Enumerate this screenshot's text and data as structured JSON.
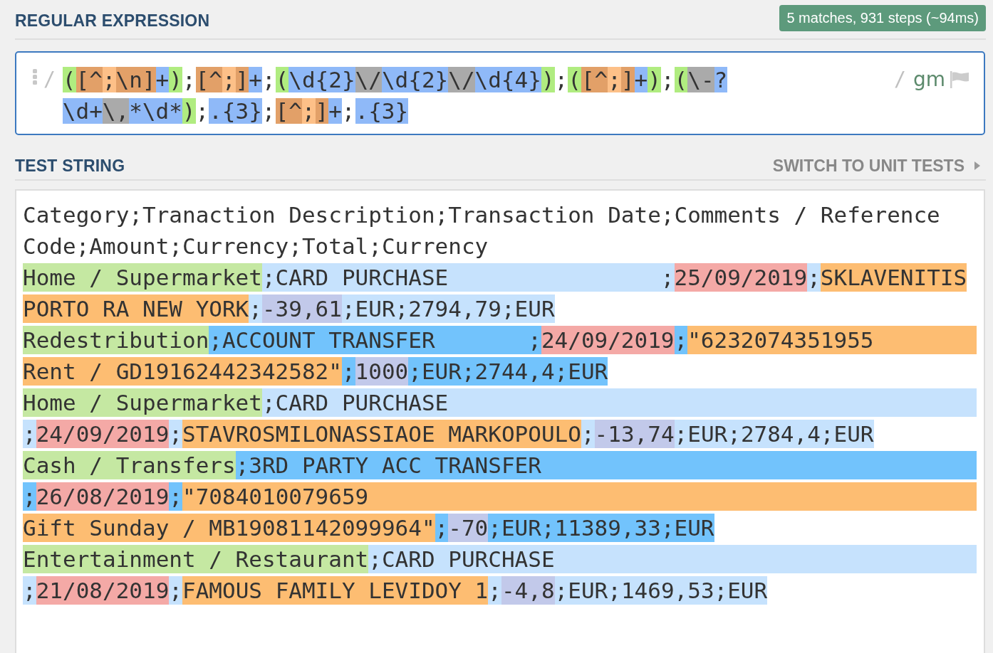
{
  "regex_section": {
    "title": "REGULAR EXPRESSION",
    "badge": "5 matches, 931 steps (~94ms)"
  },
  "regex": {
    "open_delimiter": "/",
    "close_delimiter": "/",
    "flags": "gm",
    "lines": [
      [
        {
          "text": "(",
          "kind": "group"
        },
        {
          "text": "[^",
          "kind": "set"
        },
        {
          "text": ";",
          "kind": "setitem"
        },
        {
          "text": "\\n]",
          "kind": "set"
        },
        {
          "text": "+",
          "kind": "token"
        },
        {
          "text": ")",
          "kind": "group"
        },
        {
          "text": ";",
          "kind": "plain"
        },
        {
          "text": "[^",
          "kind": "set"
        },
        {
          "text": ";",
          "kind": "setitem"
        },
        {
          "text": "]",
          "kind": "set"
        },
        {
          "text": "+",
          "kind": "token"
        },
        {
          "text": ";",
          "kind": "plain"
        },
        {
          "text": "(",
          "kind": "group"
        },
        {
          "text": "\\d{2}",
          "kind": "token"
        },
        {
          "text": "\\/",
          "kind": "escape"
        },
        {
          "text": "\\d{2}",
          "kind": "token"
        },
        {
          "text": "\\/",
          "kind": "escape"
        },
        {
          "text": "\\d{4}",
          "kind": "token"
        },
        {
          "text": ")",
          "kind": "group"
        },
        {
          "text": ";",
          "kind": "plain"
        },
        {
          "text": "(",
          "kind": "group"
        },
        {
          "text": "[^",
          "kind": "set"
        },
        {
          "text": ";",
          "kind": "setitem"
        },
        {
          "text": "]",
          "kind": "set"
        },
        {
          "text": "+",
          "kind": "token"
        },
        {
          "text": ")",
          "kind": "group"
        },
        {
          "text": ";",
          "kind": "plain"
        },
        {
          "text": "(",
          "kind": "group"
        },
        {
          "text": "\\-",
          "kind": "escape"
        },
        {
          "text": "?",
          "kind": "token"
        }
      ],
      [
        {
          "text": "\\d+",
          "kind": "token"
        },
        {
          "text": "\\,",
          "kind": "escape"
        },
        {
          "text": "*\\d*",
          "kind": "token"
        },
        {
          "text": ")",
          "kind": "group"
        },
        {
          "text": ";",
          "kind": "plain"
        },
        {
          "text": ".{3}",
          "kind": "token"
        },
        {
          "text": ";",
          "kind": "plain"
        },
        {
          "text": "[^",
          "kind": "set"
        },
        {
          "text": ";",
          "kind": "setitem"
        },
        {
          "text": "]",
          "kind": "set"
        },
        {
          "text": "+",
          "kind": "token"
        },
        {
          "text": ";",
          "kind": "plain"
        },
        {
          "text": ".{3}",
          "kind": "token"
        }
      ]
    ]
  },
  "test_section": {
    "title": "TEST STRING",
    "switch_link": "SWITCH TO UNIT TESTS"
  },
  "test_string": {
    "lines": [
      {
        "segments": [
          {
            "text": "Category;Tranaction Description;Transaction Date;Comments / Reference",
            "kind": "plain"
          }
        ]
      },
      {
        "segments": [
          {
            "text": "Code;Amount;Currency;Total;Currency",
            "kind": "plain"
          }
        ]
      },
      {
        "dark": false,
        "wrapped": false,
        "segments": [
          {
            "text": "Home / Supermarket",
            "kind": "group1"
          },
          {
            "text": ";CARD PURCHASE                ;",
            "kind": "match"
          },
          {
            "text": "25/09/2019",
            "kind": "group2"
          },
          {
            "text": ";",
            "kind": "match"
          },
          {
            "text": "SKLAVENITIS",
            "kind": "group3"
          }
        ]
      },
      {
        "dark": false,
        "wrapped": false,
        "segments": [
          {
            "text": "PORTO RA NEW YORK",
            "kind": "group3"
          },
          {
            "text": ";",
            "kind": "match"
          },
          {
            "text": "-39,61",
            "kind": "group4"
          },
          {
            "text": ";EUR;2794,79;EUR",
            "kind": "match"
          }
        ]
      },
      {
        "dark": true,
        "wrapped": true,
        "segments": [
          {
            "text": "Redestribution",
            "kind": "group1"
          },
          {
            "text": ";ACCOUNT TRANSFER       ;",
            "kind": "match"
          },
          {
            "text": "24/09/2019",
            "kind": "group2"
          },
          {
            "text": ";",
            "kind": "match"
          },
          {
            "text": "\"6232074351955",
            "kind": "group3"
          }
        ]
      },
      {
        "dark": true,
        "wrapped": false,
        "segments": [
          {
            "text": "Rent / GD19162442342582\"",
            "kind": "group3"
          },
          {
            "text": ";",
            "kind": "match"
          },
          {
            "text": "1000",
            "kind": "group4"
          },
          {
            "text": ";EUR;2744,4;EUR",
            "kind": "match"
          }
        ]
      },
      {
        "dark": false,
        "wrapped": true,
        "segments": [
          {
            "text": "Home / Supermarket",
            "kind": "group1"
          },
          {
            "text": ";CARD PURCHASE",
            "kind": "match"
          }
        ]
      },
      {
        "dark": false,
        "wrapped": false,
        "segments": [
          {
            "text": ";",
            "kind": "match"
          },
          {
            "text": "24/09/2019",
            "kind": "group2"
          },
          {
            "text": ";",
            "kind": "match"
          },
          {
            "text": "STAVROSMILONASSIAOE MARKOPOULO",
            "kind": "group3"
          },
          {
            "text": ";",
            "kind": "match"
          },
          {
            "text": "-13,74",
            "kind": "group4"
          },
          {
            "text": ";EUR;2784,4;EUR",
            "kind": "match"
          }
        ]
      },
      {
        "dark": true,
        "wrapped": true,
        "segments": [
          {
            "text": "Cash / Transfers",
            "kind": "group1"
          },
          {
            "text": ";3RD PARTY ACC TRANSFER",
            "kind": "match"
          }
        ]
      },
      {
        "dark": true,
        "wrapped": true,
        "segments": [
          {
            "text": ";",
            "kind": "match"
          },
          {
            "text": "26/08/2019",
            "kind": "group2"
          },
          {
            "text": ";",
            "kind": "match"
          },
          {
            "text": "\"7084010079659",
            "kind": "group3"
          }
        ]
      },
      {
        "dark": true,
        "wrapped": false,
        "segments": [
          {
            "text": "Gift Sunday / MB19081142099964\"",
            "kind": "group3"
          },
          {
            "text": ";",
            "kind": "match"
          },
          {
            "text": "-70",
            "kind": "group4"
          },
          {
            "text": ";EUR;11389,33;EUR",
            "kind": "match"
          }
        ]
      },
      {
        "dark": false,
        "wrapped": true,
        "segments": [
          {
            "text": "Entertainment / Restaurant",
            "kind": "group1"
          },
          {
            "text": ";CARD PURCHASE",
            "kind": "match"
          }
        ]
      },
      {
        "dark": false,
        "wrapped": false,
        "segments": [
          {
            "text": ";",
            "kind": "match"
          },
          {
            "text": "21/08/2019",
            "kind": "group2"
          },
          {
            "text": ";",
            "kind": "match"
          },
          {
            "text": "FAMOUS FAMILY LEVIDOY 1",
            "kind": "group3"
          },
          {
            "text": ";",
            "kind": "match"
          },
          {
            "text": "-4,8",
            "kind": "group4"
          },
          {
            "text": ";EUR;1469,53;EUR",
            "kind": "match"
          }
        ]
      }
    ]
  }
}
